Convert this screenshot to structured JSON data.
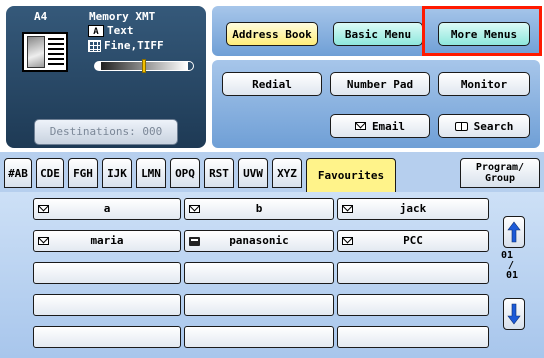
{
  "status": {
    "paper_size": "A4",
    "mode": "Memory XMT",
    "original_type": "Text",
    "original_type_icon": "text-A-icon",
    "resolution": "Fine,TIFF",
    "resolution_icon": "grid-icon",
    "contrast_level": 0.5,
    "destinations_label": "Destinations: 000"
  },
  "topmenu": {
    "address_book": "Address Book",
    "basic_menu": "Basic Menu",
    "more_menus": "More Menus"
  },
  "commands": {
    "redial": "Redial",
    "number_pad": "Number Pad",
    "monitor": "Monitor",
    "email": "Email",
    "search": "Search"
  },
  "tabs": [
    "#AB",
    "CDE",
    "FGH",
    "IJK",
    "LMN",
    "OPQ",
    "RST",
    "UVW",
    "XYZ",
    "Favourites"
  ],
  "active_tab": "Favourites",
  "program_group_tab": [
    "Program/",
    "Group"
  ],
  "entries": [
    [
      {
        "type": "email",
        "name": "a"
      },
      {
        "type": "email",
        "name": "b"
      },
      {
        "type": "email",
        "name": "jack"
      }
    ],
    [
      {
        "type": "email",
        "name": "maria"
      },
      {
        "type": "fax",
        "name": "panasonic"
      },
      {
        "type": "email",
        "name": "PCC"
      }
    ],
    [
      {
        "type": "empty",
        "name": ""
      },
      {
        "type": "empty",
        "name": ""
      },
      {
        "type": "empty",
        "name": ""
      }
    ],
    [
      {
        "type": "empty",
        "name": ""
      },
      {
        "type": "empty",
        "name": ""
      },
      {
        "type": "empty",
        "name": ""
      }
    ],
    [
      {
        "type": "empty",
        "name": ""
      },
      {
        "type": "empty",
        "name": ""
      },
      {
        "type": "empty",
        "name": ""
      }
    ]
  ],
  "pagination": {
    "current": "01",
    "separator": "/",
    "total": "01"
  },
  "colors": {
    "panel_dark": "#35597a",
    "highlight_border": "#ff1a00",
    "address_book_yellow": "#ffed7a",
    "basic_menu_teal": "#8ee7dc",
    "scroll_arrow_blue": "#1c5ad8"
  }
}
